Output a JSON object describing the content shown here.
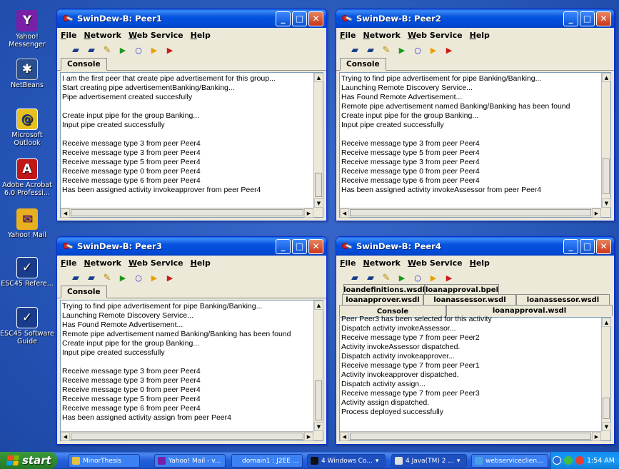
{
  "desktop": {
    "icons": [
      {
        "label": "Yahoo! Messenger",
        "icon": "yahoo-messenger-icon"
      },
      {
        "label": "NetBeans",
        "icon": "netbeans-icon"
      },
      {
        "label": "Microsoft Outlook",
        "icon": "outlook-icon"
      },
      {
        "label": "Adobe Acrobat 6.0 Professi...",
        "icon": "acrobat-icon"
      },
      {
        "label": "Yahoo! Mail",
        "icon": "yahoo-mail-icon"
      },
      {
        "label": "ESC45 Refere...",
        "icon": "epson-icon"
      },
      {
        "label": "ESC45 Software Guide",
        "icon": "epson-icon"
      }
    ]
  },
  "menu": {
    "file": "File",
    "network": "Network",
    "web_service": "Web Service",
    "help": "Help"
  },
  "windows": {
    "peer1": {
      "title": "SwinDew-B: Peer1",
      "tab": "Console",
      "console": "I am the first peer that create pipe advertisement for this group...\nStart creating pipe advertisementBanking/Banking...\nPipe advertisement created succesfully\n\nCreate input pipe for the group Banking...\nInput pipe created successfully\n\nReceive message type 3 from peer Peer4\nReceive message type 3 from peer Peer4\nReceive message type 5 from peer Peer4\nReceive message type 0 from peer Peer4\nReceive message type 6 from peer Peer4\nHas been assigned activity invokeapprover from peer Peer4"
    },
    "peer2": {
      "title": "SwinDew-B: Peer2",
      "tab": "Console",
      "console": "Trying to find pipe advertisement for pipe Banking/Banking...\nLaunching Remote Discovery Service...\nHas Found Remote Advertisement...\nRemote pipe advertisement named Banking/Banking has been found\nCreate input pipe for the group Banking...\nInput pipe created successfully\n\nReceive message type 3 from peer Peer4\nReceive message type 5 from peer Peer4\nReceive message type 3 from peer Peer4\nReceive message type 0 from peer Peer4\nReceive message type 6 from peer Peer4\nHas been assigned activity invokeAssessor from peer Peer4"
    },
    "peer3": {
      "title": "SwinDew-B: Peer3",
      "tab": "Console",
      "console": "Trying to find pipe advertisement for pipe Banking/Banking...\nLaunching Remote Discovery Service...\nHas Found Remote Advertisement...\nRemote pipe advertisement named Banking/Banking has been found\nCreate input pipe for the group Banking...\nInput pipe created successfully\n\nReceive message type 3 from peer Peer4\nReceive message type 3 from peer Peer4\nReceive message type 0 from peer Peer4\nReceive message type 5 from peer Peer4\nReceive message type 6 from peer Peer4\nHas been assigned activity assign from peer Peer4"
    },
    "peer4": {
      "title": "SwinDew-B: Peer4",
      "tabs_row1": [
        "loandefinitions.wsdl",
        "loanapproval.bpel"
      ],
      "tabs_row2": [
        "loanapprover.wsdl",
        "loanassessor.wsdl",
        "loanassessor.wsdl"
      ],
      "tabs_row3": [
        "Console",
        "loanapproval.wsdl"
      ],
      "console": "Peer Peer3 has been selected for this activity\nDispatch activity invokeAssessor...\nReceive message type 7 from peer Peer2\nActivity invokeAssessor dispatched.\nDispatch activity invokeapprover...\nReceive message type 7 from peer Peer1\nActivity invokeapprover dispatched.\nDispatch activity assign...\nReceive message type 7 from peer Peer3\nActivity assign dispatched.\nProcess deployed successfully"
    }
  },
  "taskbar": {
    "start": "start",
    "buttons": [
      "MinorThesis",
      "Yahoo! Mail - v...",
      "domain1 : J2EE ...",
      "4 Windows Co...",
      "4 Java(TM) 2 ...",
      "webserviceclien..."
    ],
    "clock": "1:54 AM"
  },
  "colors": {
    "titlebar": "#0553e0",
    "desktop": "#2756b8",
    "taskbar": "#245edb",
    "start": "#2f8a2f"
  }
}
